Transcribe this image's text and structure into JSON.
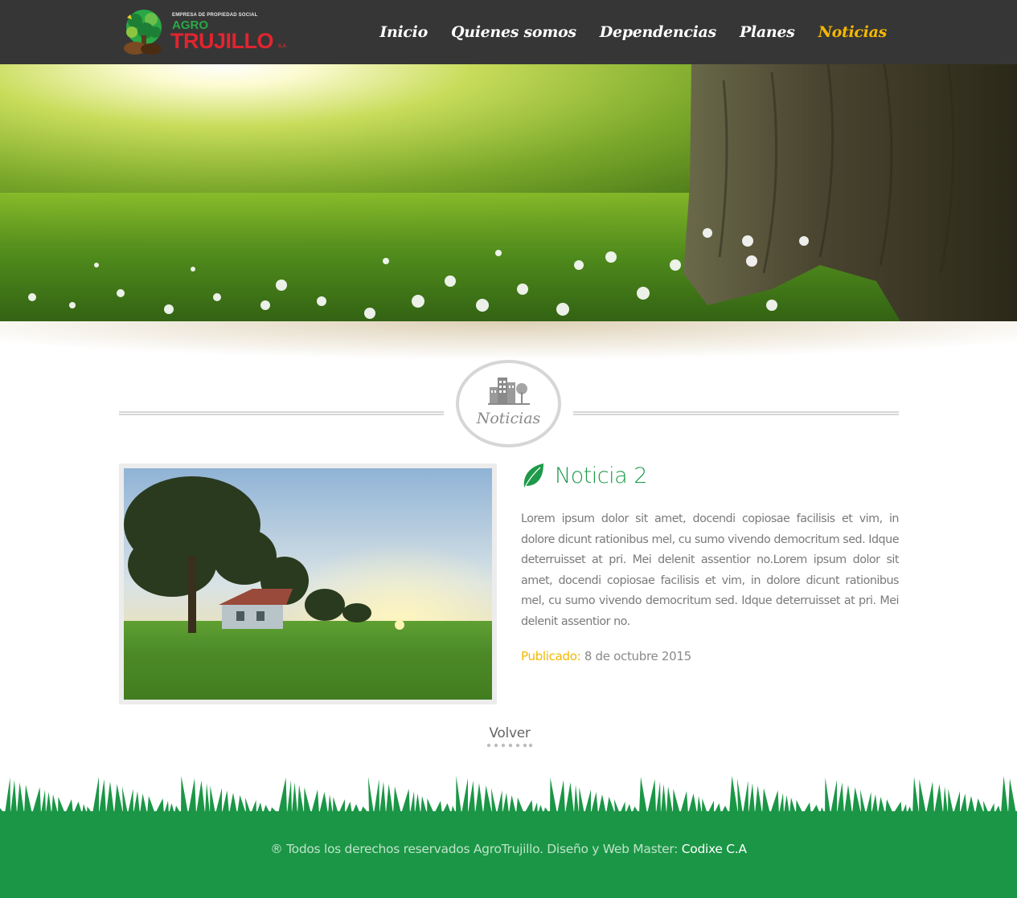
{
  "header": {
    "logo": {
      "tagline": "EMPRESA DE PROPIEDAD SOCIAL",
      "brand_top": "AGRO",
      "brand_main": "TRUJILLO",
      "brand_suffix": "S.A"
    },
    "nav": [
      {
        "label": "Inicio",
        "active": false
      },
      {
        "label": "Quienes somos",
        "active": false
      },
      {
        "label": "Dependencias",
        "active": false
      },
      {
        "label": "Planes",
        "active": false
      },
      {
        "label": "Noticias",
        "active": true
      }
    ]
  },
  "section": {
    "title": "Noticias",
    "icon": "city-buildings-icon"
  },
  "article": {
    "title": "Noticia 2",
    "title_icon": "leaf-icon",
    "body": "Lorem ipsum dolor sit amet, docendi copiosae facilisis et vim, in dolore dicunt rationibus mel, cu sumo vivendo democritum sed. Idque deterruisset at pri. Mei delenit assentior no.Lorem ipsum dolor sit amet, docendi copiosae facilisis et vim, in dolore dicunt rationibus mel, cu sumo vivendo democritum sed. Idque deterruisset at pri. Mei delenit assentior no.",
    "published_label": "Publicado:",
    "published_date": "8 de octubre 2015"
  },
  "back_link": "Volver",
  "footer": {
    "text": "® Todos los derechos reservados AgroTrujillo. Diseño y Web Master:",
    "credit": "Codixe C.A"
  },
  "colors": {
    "header_bg": "#363636",
    "nav_active": "#f5b800",
    "accent_green": "#1e9a4a",
    "footer_green": "#1b9646"
  }
}
